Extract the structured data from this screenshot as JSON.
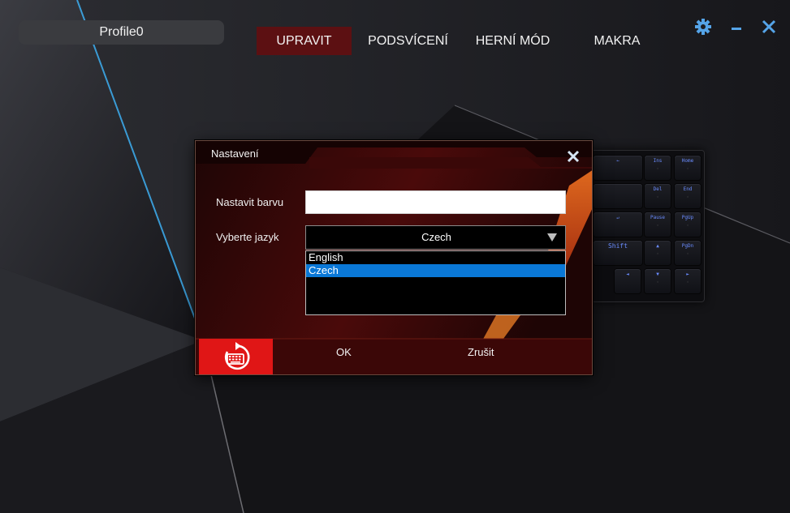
{
  "profile": {
    "name": "Profile0"
  },
  "nav": {
    "tabs": [
      {
        "label": "UPRAVIT",
        "active": true
      },
      {
        "label": "PODSVÍCENÍ",
        "active": false
      },
      {
        "label": "HERNÍ MÓD",
        "active": false
      },
      {
        "label": "MAKRA",
        "active": false
      }
    ]
  },
  "window_controls": {
    "icons": [
      "gear-icon",
      "minimize-icon",
      "close-icon"
    ]
  },
  "keyboard": {
    "keys": [
      "←",
      "Ins",
      "Home",
      "",
      "Del",
      "End",
      "↵",
      "Pause",
      "PgUp",
      "Shift",
      "▲",
      "PgDn",
      "◄",
      "▼",
      "►"
    ],
    "key_color": "#6a8cff"
  },
  "dialog": {
    "title": "Nastavení",
    "color_label": "Nastavit barvu",
    "color_value": "",
    "language_label": "Vyberte jazyk",
    "language_selected": "Czech",
    "language_options": [
      "English",
      "Czech"
    ],
    "ok_label": "OK",
    "cancel_label": "Zrušit",
    "reset_icon": "keyboard-reset-icon"
  },
  "colors": {
    "active_tab": "#5c1012",
    "accent_red": "#e01616",
    "selection_blue": "#0a78d7",
    "icon_blue": "#55a4e8"
  }
}
